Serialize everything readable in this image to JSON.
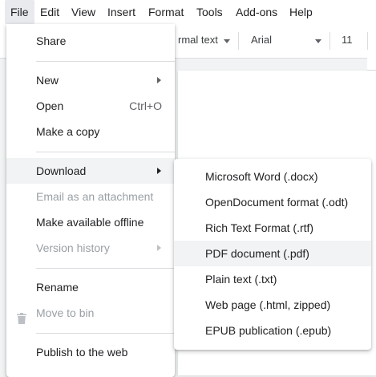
{
  "menubar": {
    "items": [
      "File",
      "Edit",
      "View",
      "Insert",
      "Format",
      "Tools",
      "Add-ons",
      "Help"
    ]
  },
  "toolbar": {
    "style_value": "rmal text",
    "font_value": "Arial",
    "size_value": "11"
  },
  "file_menu": {
    "share": "Share",
    "new": "New",
    "open": "Open",
    "open_shortcut": "Ctrl+O",
    "make_copy": "Make a copy",
    "download": "Download",
    "email_attachment": "Email as an attachment",
    "make_offline": "Make available offline",
    "version_history": "Version history",
    "rename": "Rename",
    "move_to_bin": "Move to bin",
    "publish": "Publish to the web"
  },
  "download_menu": {
    "items": [
      "Microsoft Word (.docx)",
      "OpenDocument format (.odt)",
      "Rich Text Format (.rtf)",
      "PDF document (.pdf)",
      "Plain text (.txt)",
      "Web page (.html, zipped)",
      "EPUB publication (.epub)"
    ]
  },
  "colors": {
    "text": "#202124",
    "disabled": "#9aa0a6",
    "hover_bg": "#f1f3f4",
    "separator": "#dadce0"
  }
}
